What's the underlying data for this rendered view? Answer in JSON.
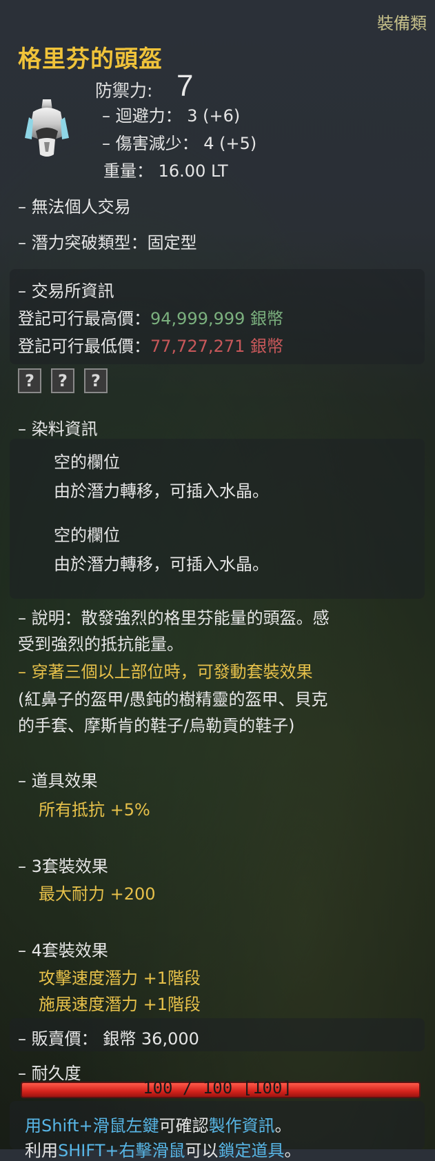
{
  "category": "裝備類",
  "item": {
    "name": "格里芬的頭盔",
    "defense_label": "防禦力:",
    "defense_value": "7",
    "evasion": "– 迴避力： 3 (+6)",
    "damage_reduction": "– 傷害減少： 4 (+5)",
    "weight": "重量： 16.00 LT",
    "icon": "helmet-icon"
  },
  "props": {
    "no_trade": "– 無法個人交易",
    "enhance_type": "– 潛力突破類型：固定型"
  },
  "market": {
    "header": "– 交易所資訊",
    "max_label": "登記可行最高價：",
    "max_value": "94,999,999 銀幣",
    "min_label": "登記可行最低價：",
    "min_value": "77,727,271 銀幣"
  },
  "slots": [
    "?",
    "?",
    "?"
  ],
  "dye": {
    "header": "– 染料資訊",
    "slot1_title": "空的欄位",
    "slot1_desc": "由於潛力轉移，可插入水晶。",
    "slot2_title": "空的欄位",
    "slot2_desc": "由於潛力轉移，可插入水晶。"
  },
  "description": {
    "line1": "– 說明：散發強烈的格里芬能量的頭盔。感",
    "line2": "受到強烈的抵抗能量。",
    "set_line": "– 穿著三個以上部位時，可發動套裝效果",
    "parts1": "(紅鼻子的盔甲/愚鈍的樹精靈的盔甲、貝克",
    "parts2": "的手套、摩斯肯的鞋子/烏勒貢的鞋子)"
  },
  "effects": {
    "item_header": "– 道具效果",
    "item_1": "所有抵抗 +5%",
    "set3_header": "– 3套裝效果",
    "set3_1": "最大耐力 +200",
    "set4_header": "– 4套裝效果",
    "set4_1": "攻擊速度潛力 +1階段",
    "set4_2": "施展速度潛力 +1階段"
  },
  "sell": {
    "label": "– 販賣價：",
    "value": "銀幣 36,000"
  },
  "durability": {
    "label": "– 耐久度",
    "text": "100 / 100 [100]",
    "fraction": 1.0
  },
  "hints": {
    "h1_a": "用Shift+滑鼠左鍵",
    "h1_b": "可確認",
    "h1_c": "製作資訊",
    "h1_d": "。",
    "h2_a": "利用",
    "h2_b": "SHIFT+右擊滑鼠",
    "h2_c": "可以",
    "h2_d": "鎖定道具",
    "h2_e": "。"
  },
  "colors": {
    "title": "#f0c33a",
    "price_high": "#7bb07e",
    "price_low": "#c8585a",
    "effect": "#e7c14a",
    "hint": "#58b6e6",
    "durability_bar": "#d4231c"
  }
}
